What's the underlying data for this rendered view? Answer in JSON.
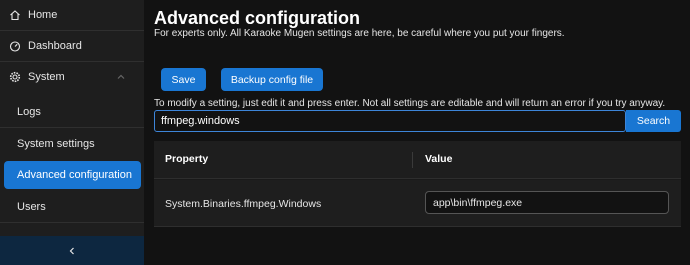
{
  "sidebar": {
    "home": "Home",
    "dashboard": "Dashboard",
    "system": "System",
    "logs": "Logs",
    "system_settings": "System settings",
    "advanced_configuration": "Advanced configuration",
    "users": "Users"
  },
  "main": {
    "title": "Advanced configuration",
    "subtitle": "For experts only. All Karaoke Mugen settings are here, be careful where you put your fingers.",
    "save_label": "Save",
    "backup_label": "Backup config file",
    "hint": "To modify a setting, just edit it and press enter. Not all settings are editable and will return an error if you try anyway.",
    "search_value": "ffmpeg.windows",
    "search_label": "Search"
  },
  "table": {
    "columns": [
      "Property",
      "Value"
    ],
    "rows": [
      {
        "property": "System.Binaries.ffmpeg.Windows",
        "value": "app\\bin\\ffmpeg.exe"
      }
    ]
  },
  "colors": {
    "accent": "#1976d2",
    "background": "#121212",
    "sidebar": "#1e1e1e"
  }
}
